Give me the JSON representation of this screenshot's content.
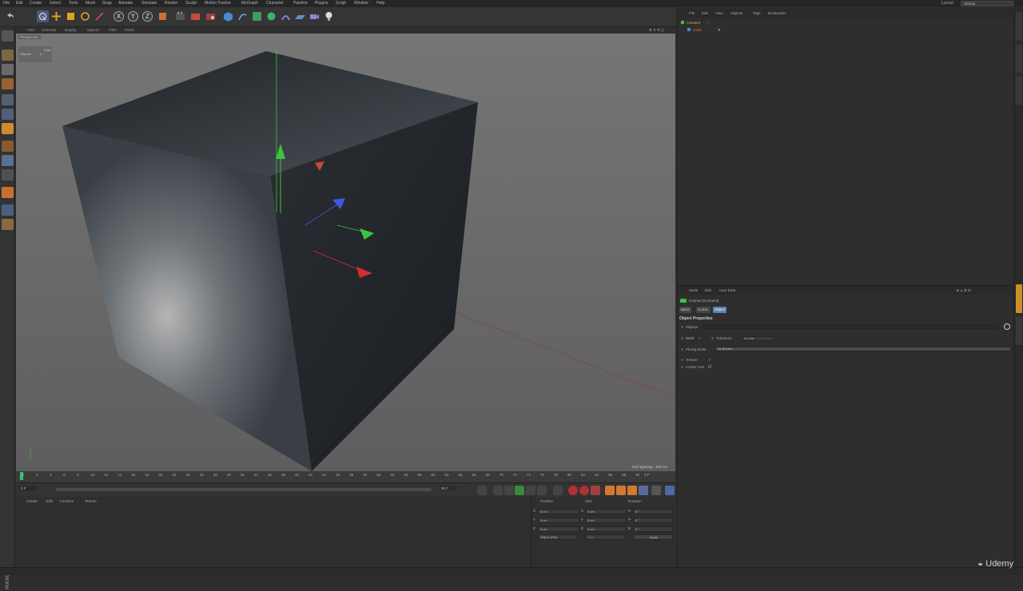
{
  "menubar": {
    "items": [
      "File",
      "Edit",
      "Create",
      "Select",
      "Tools",
      "Mesh",
      "Snap",
      "Animate",
      "Simulate",
      "Render",
      "Sculpt",
      "Motion Tracker",
      "MoGraph",
      "Character",
      "Pipeline",
      "Plugins",
      "Script",
      "Window",
      "Help"
    ],
    "layout_label": "Layout:",
    "layout_value": "Startup"
  },
  "viewport": {
    "menu": [
      "View",
      "Cameras",
      "Display",
      "Options",
      "Filter",
      "Panel"
    ],
    "label": "Perspective",
    "hud_title": "Total",
    "hud_row_label": "Objects",
    "hud_row_value": "0",
    "grid_spacing": "Grid Spacing : 100 cm"
  },
  "timeline": {
    "ticks": [
      "0",
      "2",
      "4",
      "6",
      "8",
      "10",
      "12",
      "14",
      "16",
      "18",
      "20",
      "22",
      "24",
      "26",
      "28",
      "30",
      "32",
      "34",
      "36",
      "38",
      "40",
      "42",
      "44",
      "46",
      "48",
      "50",
      "52",
      "54",
      "56",
      "58",
      "60",
      "62",
      "64",
      "66",
      "68",
      "70",
      "72",
      "74",
      "76",
      "78",
      "80",
      "82",
      "84",
      "86",
      "88",
      "90"
    ],
    "current_frame": "0 F",
    "start_frame": "0 F",
    "end_frame": "90 F"
  },
  "material_manager": {
    "menu": [
      "Create",
      "Edit",
      "Function",
      "Texture"
    ]
  },
  "coordinates": {
    "headers": [
      "Position",
      "Size",
      "Rotation"
    ],
    "rows": [
      {
        "axis": "X",
        "pos": "0 cm",
        "size_axis": "X",
        "size": "0 cm",
        "rot_axis": "H",
        "rot": "0 °"
      },
      {
        "axis": "Y",
        "pos": "0 cm",
        "size_axis": "Y",
        "size": "0 cm",
        "rot_axis": "P",
        "rot": "0 °"
      },
      {
        "axis": "Z",
        "pos": "0 cm",
        "size_axis": "Z",
        "size": "0 cm",
        "rot_axis": "B",
        "rot": "0 °"
      }
    ],
    "mode_select": "Object (Rel)",
    "size_select": "Size",
    "apply_label": "Apply"
  },
  "object_manager": {
    "menu": [
      "File",
      "Edit",
      "View",
      "Objects",
      "Tags",
      "Bookmarks"
    ],
    "objects": [
      {
        "name": "Connect",
        "color": "#e8b84a",
        "indent": 0
      },
      {
        "name": "Cube",
        "color": "#e07a3a",
        "indent": 1
      }
    ]
  },
  "attribute_manager": {
    "menu": [
      "Mode",
      "Edit",
      "User Data"
    ],
    "object_name": "Connect [Connect]",
    "tabs": [
      "Basic",
      "Coord.",
      "Object"
    ],
    "active_tab": "Object",
    "section_title": "Object Properties",
    "props": {
      "objects_label": "Objects",
      "weld_label": "Weld",
      "weld_value": "✓",
      "tolerance_label": "Tolerance",
      "tolerance_value": "0.1 cm",
      "phong_label": "Phong Mode",
      "phong_value": "As Breaks",
      "texture_label": "Texture",
      "texture_value": "✓",
      "center_axis_label": "Center Axis",
      "center_axis_value": ""
    }
  },
  "watermark": "Udemy",
  "colors": {
    "axis_x": "#d03030",
    "axis_y": "#3cc43c",
    "axis_z": "#3a5ad8",
    "active_tab": "#5b7fb5",
    "playhead": "#39c16c"
  }
}
